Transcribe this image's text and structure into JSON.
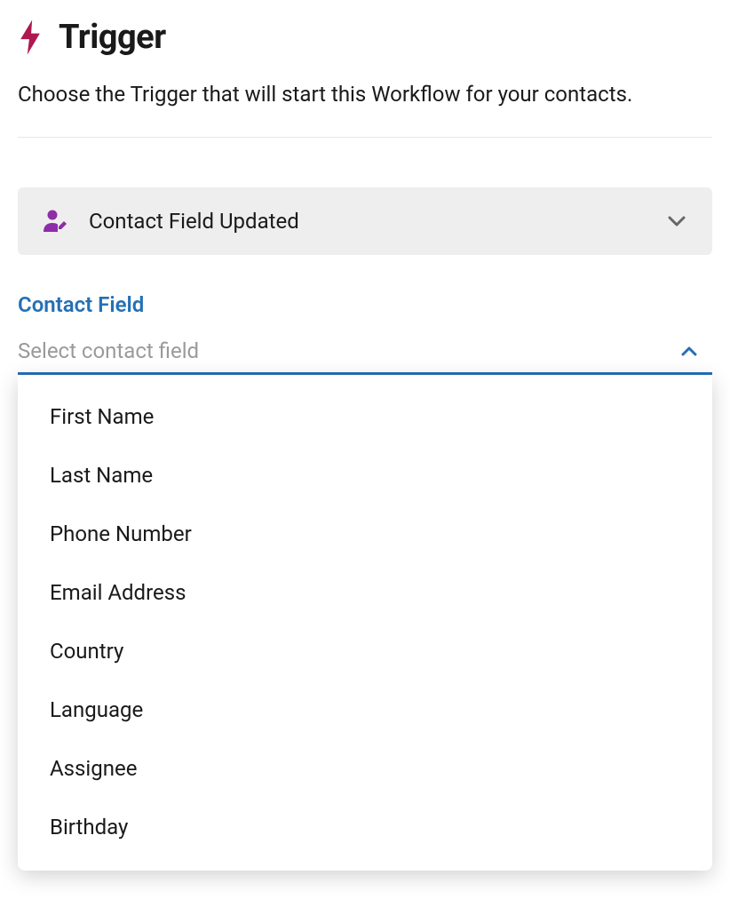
{
  "header": {
    "title": "Trigger"
  },
  "description": "Choose the Trigger that will start this Workflow for your contacts.",
  "triggerSelect": {
    "label": "Contact Field Updated"
  },
  "fieldSelect": {
    "label": "Contact Field",
    "placeholder": "Select contact field",
    "options": [
      "First Name",
      "Last Name",
      "Phone Number",
      "Email Address",
      "Country",
      "Language",
      "Assignee",
      "Birthday"
    ]
  }
}
